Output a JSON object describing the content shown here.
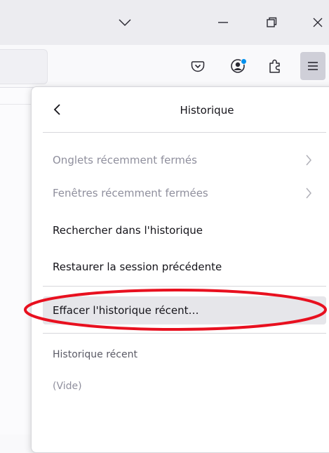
{
  "panel": {
    "title": "Historique",
    "items": [
      {
        "label": "Onglets récemment fermés",
        "disabled": true,
        "submenu": true
      },
      {
        "label": "Fenêtres récemment fermées",
        "disabled": true,
        "submenu": true
      },
      {
        "label": "Rechercher dans l'historique",
        "disabled": false
      },
      {
        "label": "Restaurer la session précédente",
        "disabled": false
      },
      {
        "label": "Effacer l'historique récent…",
        "disabled": false,
        "highlighted": true
      }
    ],
    "recent_heading": "Historique récent",
    "empty_label": "(Vide)"
  },
  "colors": {
    "annotation": "#e8101f",
    "notification_dot": "#0090ed"
  }
}
